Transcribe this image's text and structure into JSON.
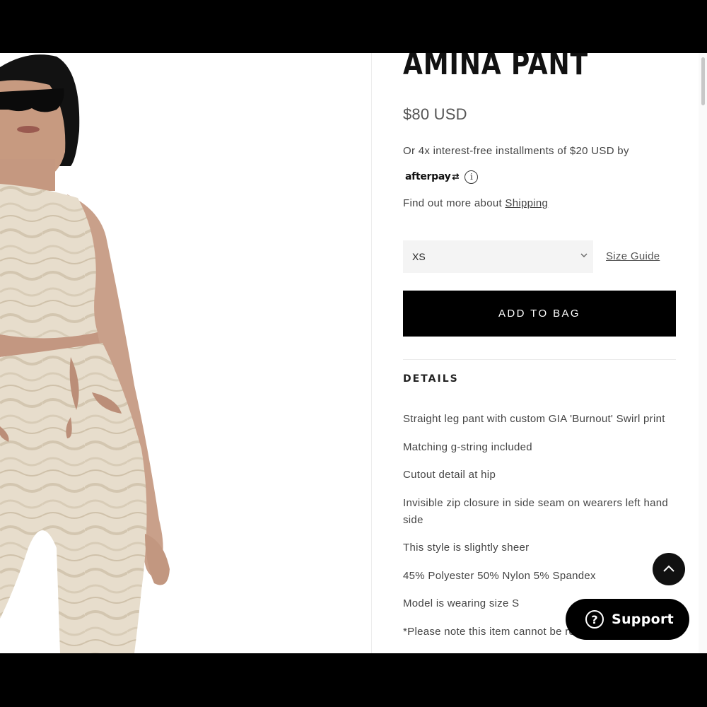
{
  "product": {
    "title": "AMINA PANT",
    "price": "$80 USD",
    "installments_text": "Or 4x interest-free installments of $20 USD by",
    "afterpay_logo": "afterpay",
    "shipping_prefix": "Find out more about ",
    "shipping_link": "Shipping",
    "size_selected": "XS",
    "size_guide_label": "Size Guide",
    "add_to_bag_label": "ADD TO BAG",
    "details_heading": "DETAILS",
    "details": [
      "Straight leg pant with custom GIA 'Burnout' Swirl print",
      "Matching g-string included",
      "Cutout detail at hip",
      "Invisible zip closure in side seam on wearers left hand side",
      "This style is slightly sheer",
      "45% Polyester 50% Nylon 5% Spandex",
      "Model is wearing size S",
      "*Please note this item cannot be returned as it"
    ]
  },
  "floating": {
    "support_label": "Support",
    "support_icon": "question-circle-icon",
    "back_to_top_icon": "chevron-up-icon"
  },
  "image": {
    "alt": "Model wearing Amina Pant and matching top in beige swirl print"
  },
  "colors": {
    "button_bg": "#000000",
    "select_bg": "#f4f4f4",
    "text_muted": "#444444",
    "fabric": "#e6dccb"
  }
}
